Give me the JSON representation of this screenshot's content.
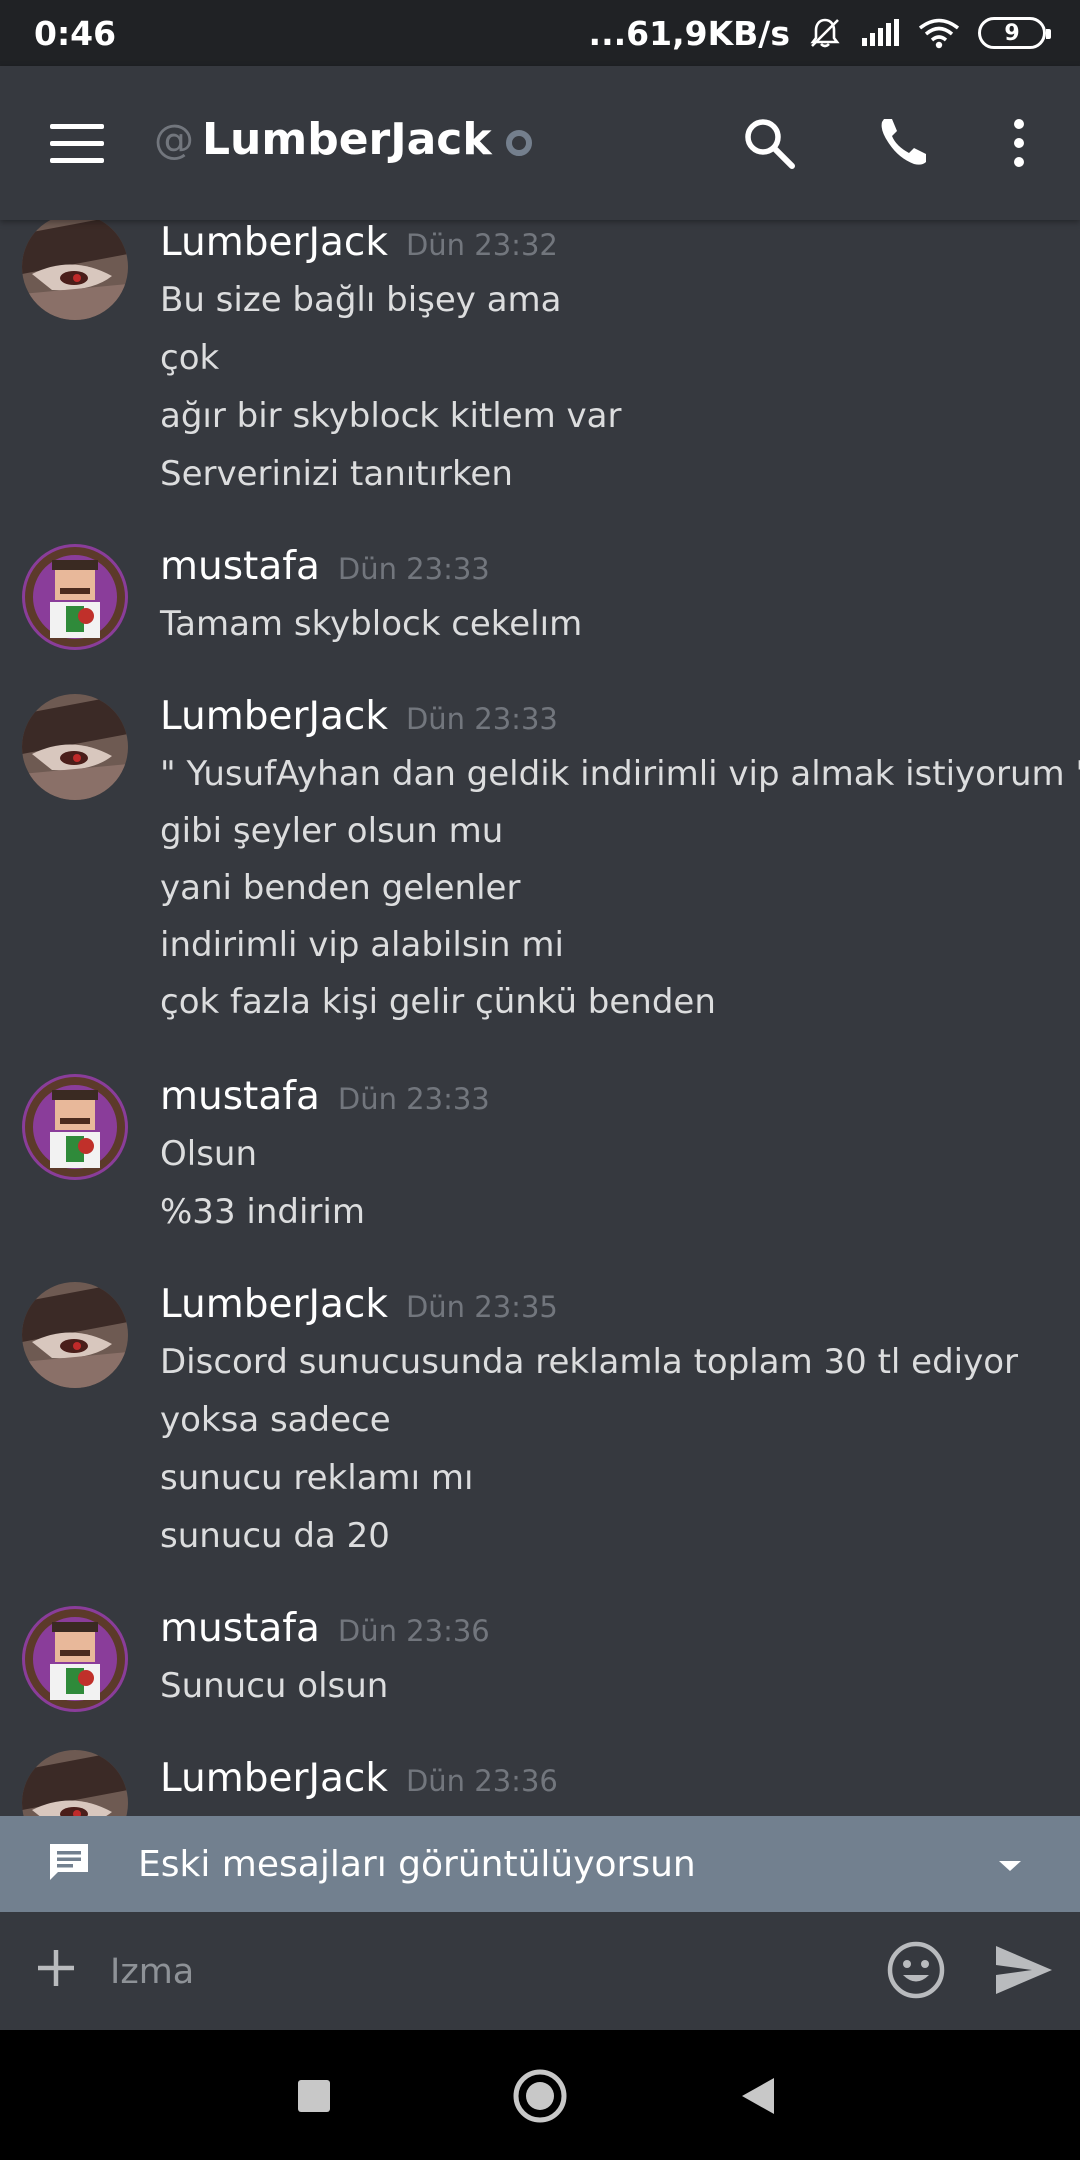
{
  "status_bar": {
    "time": "0:46",
    "network_speed": "...61,9KB/s",
    "battery_level": "9"
  },
  "header": {
    "at_symbol": "@",
    "channel_name": "LumberJack"
  },
  "messages": [
    {
      "author": "LumberJack",
      "timestamp": "Dün 23:32",
      "avatar": "lumberjack-avatar",
      "lines": [
        "Bu size bağlı bişey ama",
        "çok",
        "ağır bir skyblock kitlem var",
        "Serverinizi tanıtırken"
      ]
    },
    {
      "author": "mustafa",
      "timestamp": "Dün 23:33",
      "avatar": "mustafa-avatar",
      "lines": [
        "Tamam skyblock cekelım"
      ]
    },
    {
      "author": "LumberJack",
      "timestamp": "Dün 23:33",
      "avatar": "lumberjack-avatar",
      "lines": [
        "\" YusufAyhan dan geldik indirimli vip almak istiyorum \"",
        "gibi şeyler olsun mu",
        "yani benden gelenler",
        "indirimli vip alabilsin mi",
        "çok fazla kişi gelir çünkü benden"
      ]
    },
    {
      "author": "mustafa",
      "timestamp": "Dün 23:33",
      "avatar": "mustafa-avatar",
      "lines": [
        "Olsun",
        "%33 indirim"
      ]
    },
    {
      "author": "LumberJack",
      "timestamp": "Dün 23:35",
      "avatar": "lumberjack-avatar",
      "lines": [
        "Discord sunucusunda reklamla toplam 30 tl ediyor",
        "yoksa sadece",
        "sunucu reklamı mı",
        "sunucu da 20"
      ]
    },
    {
      "author": "mustafa",
      "timestamp": "Dün 23:36",
      "avatar": "mustafa-avatar",
      "lines": [
        "Sunucu olsun"
      ]
    },
    {
      "author": "LumberJack",
      "timestamp": "Dün 23:36",
      "avatar": "lumberjack-avatar",
      "lines": []
    }
  ],
  "old_messages_bar": {
    "text": "Eski mesajları görüntülüyorsun"
  },
  "input": {
    "value": "",
    "placeholder": "Izma"
  },
  "colors": {
    "background": "#36393f",
    "status_bar": "#202225",
    "old_bar": "#72808f",
    "muted_text": "#72767d",
    "message_text": "#dcddde"
  }
}
